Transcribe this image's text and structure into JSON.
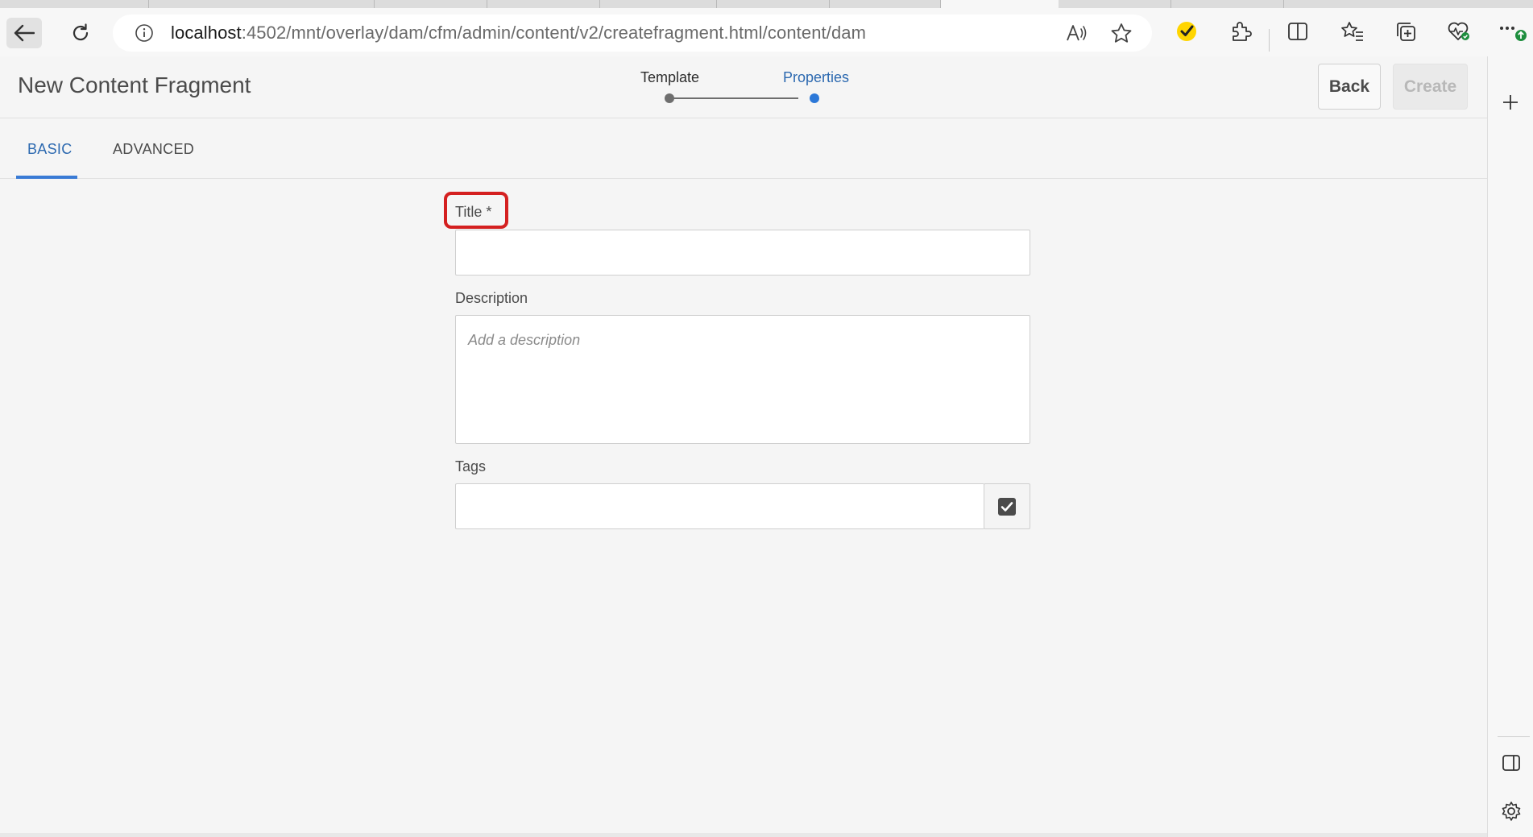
{
  "browser": {
    "url_host": "localhost",
    "url_path": ":4502/mnt/overlay/dam/cfm/admin/content/v2/createfragment.html/content/dam",
    "icons": {
      "back": "back-arrow-icon",
      "reload": "reload-icon",
      "info": "info-icon",
      "read_aloud": "read-aloud-icon",
      "favorite": "star-icon",
      "extension_norton": "check-shield-icon",
      "extensions": "puzzle-icon",
      "split": "split-screen-icon",
      "favorites": "favorites-icon",
      "collections": "collections-icon",
      "performance": "heart-pulse-icon",
      "more": "more-icon"
    }
  },
  "page": {
    "title": "New Content Fragment"
  },
  "wizard": {
    "steps": [
      {
        "label": "Template",
        "state": "done"
      },
      {
        "label": "Properties",
        "state": "current"
      }
    ]
  },
  "actions": {
    "back_label": "Back",
    "create_label": "Create"
  },
  "tabs": [
    {
      "label": "BASIC",
      "active": true
    },
    {
      "label": "ADVANCED",
      "active": false
    }
  ],
  "form": {
    "title_label": "Title *",
    "title_value": "",
    "description_label": "Description",
    "description_placeholder": "Add a description",
    "tags_label": "Tags",
    "tags_value": ""
  },
  "colors": {
    "accent": "#2c69b0",
    "highlight": "#d42020"
  }
}
